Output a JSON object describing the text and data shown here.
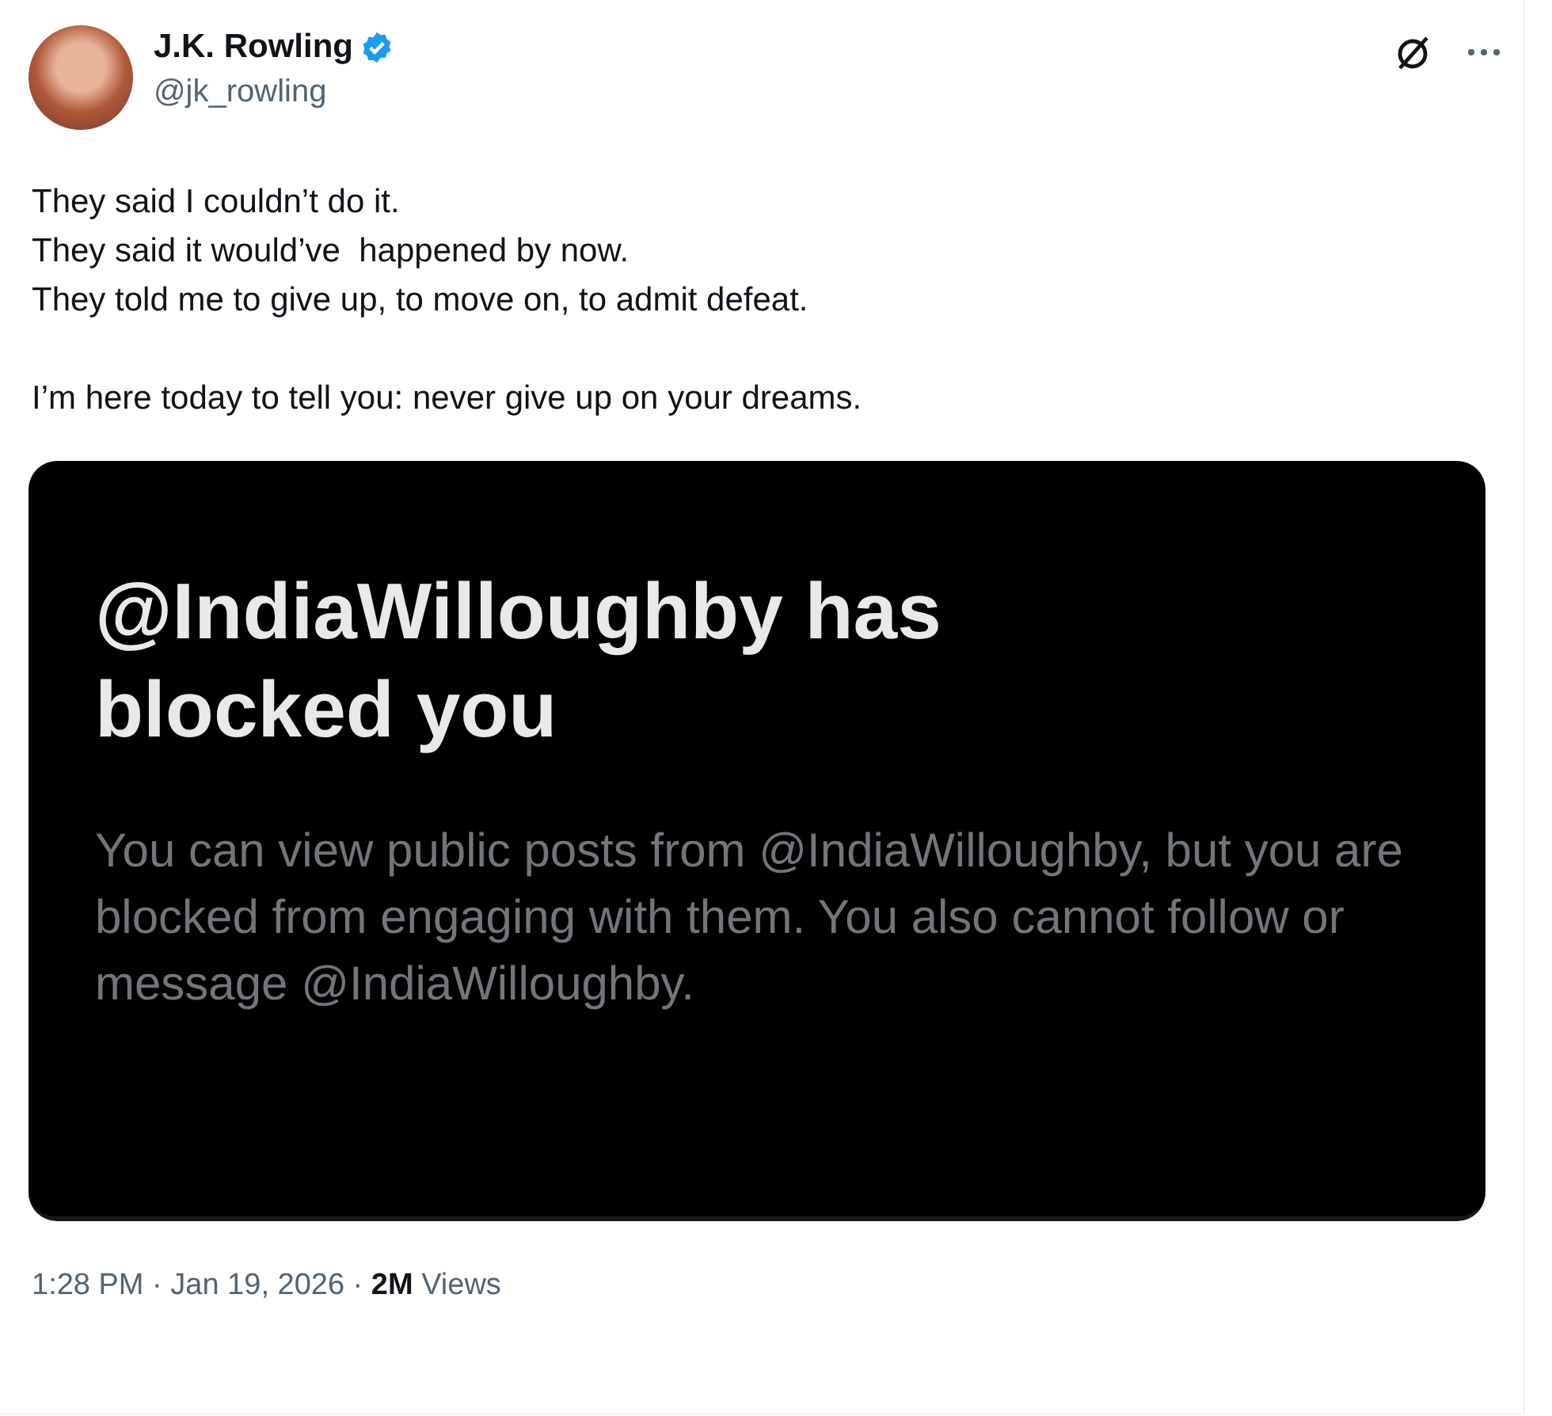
{
  "author": {
    "name": "J.K. Rowling",
    "verified": true,
    "handle": "@jk_rowling"
  },
  "body": [
    [
      "They said I couldn’t do it.",
      "They said it would’ve  happened by now.",
      "They told me to give up, to move on, to admit defeat."
    ],
    [
      "I’m here today to tell you: never give up on your dreams."
    ]
  ],
  "media": {
    "title": "@IndiaWilloughby has blocked you",
    "text": "You can view public posts from @IndiaWilloughby, but you are blocked from engaging with them. You also cannot follow or message @IndiaWilloughby."
  },
  "meta": "1:28 PM · Jan 19, 2026 · **2M** Views"
}
